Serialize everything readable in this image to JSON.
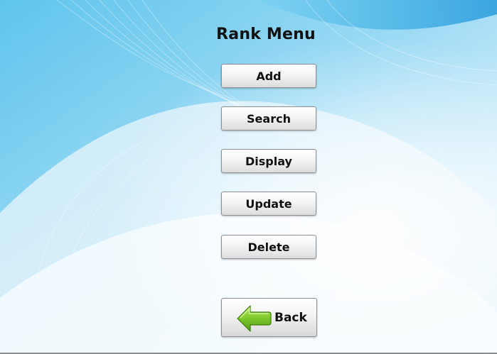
{
  "title": "Rank Menu",
  "buttons": {
    "add": "Add",
    "search": "Search",
    "display": "Display",
    "update": "Update",
    "delete": "Delete",
    "back": "Back"
  },
  "icons": {
    "back": "back-arrow-icon"
  },
  "colors": {
    "background_light": "#eaf6fc",
    "background_blue": "#6ccbee",
    "back_arrow_green": "#7cc72a"
  }
}
